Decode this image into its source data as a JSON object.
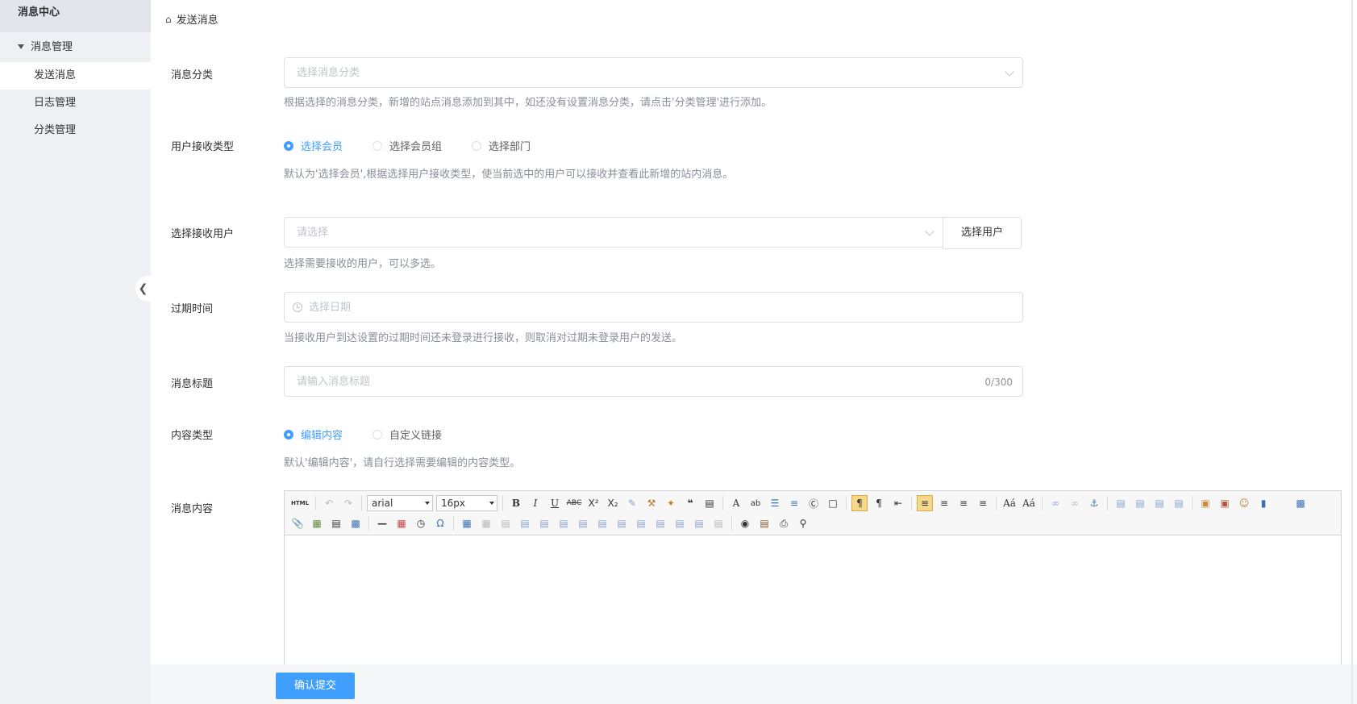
{
  "sidebar": {
    "title": "消息中心",
    "group": "消息管理",
    "items": [
      {
        "label": "发送消息",
        "active": true
      },
      {
        "label": "日志管理",
        "active": false
      },
      {
        "label": "分类管理",
        "active": false
      }
    ]
  },
  "breadcrumb": {
    "label": "发送消息"
  },
  "form": {
    "category": {
      "label": "消息分类",
      "placeholder": "选择消息分类",
      "hint": "根据选择的消息分类，新增的站点消息添加到其中，如还没有设置消息分类，请点击'分类管理'进行添加。"
    },
    "receive_type": {
      "label": "用户接收类型",
      "options": [
        "选择会员",
        "选择会员组",
        "选择部门"
      ],
      "selected": "选择会员",
      "hint": "默认为'选择会员',根据选择用户接收类型，使当前选中的用户可以接收并查看此新增的站内消息。"
    },
    "receivers": {
      "label": "选择接收用户",
      "placeholder": "请选择",
      "button": "选择用户",
      "hint": "选择需要接收的用户，可以多选。"
    },
    "expire": {
      "label": "过期时间",
      "placeholder": "选择日期",
      "hint": "当接收用户到达设置的过期时间还未登录进行接收，则取消对过期未登录用户的发送。"
    },
    "title": {
      "label": "消息标题",
      "placeholder": "请输入消息标题",
      "counter": "0/300"
    },
    "content_type": {
      "label": "内容类型",
      "options": [
        "编辑内容",
        "自定义链接"
      ],
      "selected": "编辑内容",
      "hint": "默认'编辑内容'，请自行选择需要编辑的内容类型。"
    },
    "content": {
      "label": "消息内容",
      "font_family": "arial",
      "font_size": "16px",
      "html_button": "HTML"
    }
  },
  "footer": {
    "submit": "确认提交"
  },
  "colors": {
    "accent": "#409eff",
    "sidebar_bg": "#eef0f3"
  }
}
